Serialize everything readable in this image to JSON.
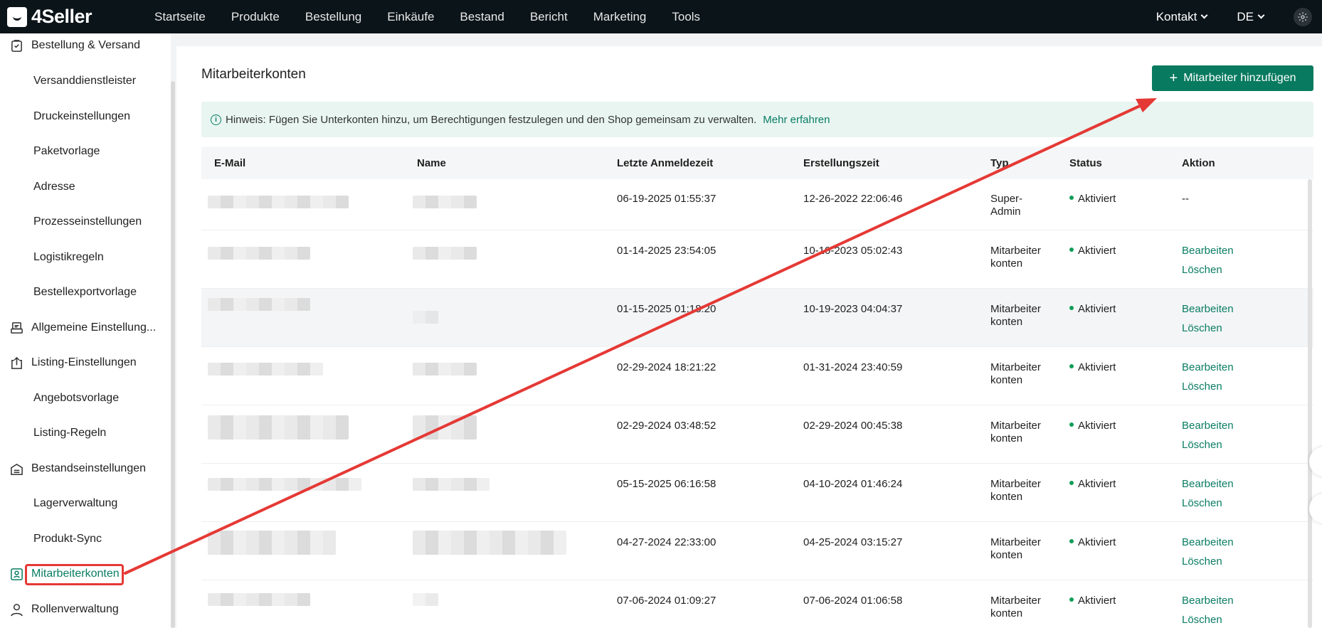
{
  "brand": {
    "name": "4Seller"
  },
  "nav": {
    "items": [
      "Startseite",
      "Produkte",
      "Bestellung",
      "Einkäufe",
      "Bestand",
      "Bericht",
      "Marketing",
      "Tools"
    ],
    "contact": "Kontakt",
    "language": "DE"
  },
  "sidebar": {
    "items": [
      {
        "label": "Bestellung & Versand",
        "type": "group",
        "icon": "clipboard-icon"
      },
      {
        "label": "Versanddienstleister",
        "type": "sub"
      },
      {
        "label": "Druckeinstellungen",
        "type": "sub"
      },
      {
        "label": "Paketvorlage",
        "type": "sub"
      },
      {
        "label": "Adresse",
        "type": "sub"
      },
      {
        "label": "Prozesseinstellungen",
        "type": "sub"
      },
      {
        "label": "Logistikregeln",
        "type": "sub"
      },
      {
        "label": "Bestellexportvorlage",
        "type": "sub"
      },
      {
        "label": "Allgemeine Einstellung...",
        "type": "group",
        "icon": "printer-icon"
      },
      {
        "label": "Listing-Einstellungen",
        "type": "group",
        "icon": "upload-icon"
      },
      {
        "label": "Angebotsvorlage",
        "type": "sub"
      },
      {
        "label": "Listing-Regeln",
        "type": "sub"
      },
      {
        "label": "Bestandseinstellungen",
        "type": "group",
        "icon": "inventory-icon"
      },
      {
        "label": "Lagerverwaltung",
        "type": "sub"
      },
      {
        "label": "Produkt-Sync",
        "type": "sub"
      },
      {
        "label": "Mitarbeiterkonten",
        "type": "group",
        "icon": "badge-icon",
        "active": true
      },
      {
        "label": "Rollenverwaltung",
        "type": "group",
        "icon": "user-icon"
      }
    ]
  },
  "page": {
    "title": "Mitarbeiterkonten",
    "add_button": "Mitarbeiter hinzufügen",
    "hint": "Hinweis: Fügen Sie Unterkonten hinzu, um Berechtigungen festzulegen und den Shop gemeinsam zu verwalten.",
    "hint_link": "Mehr erfahren"
  },
  "table": {
    "columns": [
      "E-Mail",
      "Name",
      "Letzte Anmeldezeit",
      "Erstellungszeit",
      "Typ",
      "Status",
      "Aktion"
    ],
    "rows": [
      {
        "last_login": "06-19-2025 01:55:37",
        "created": "12-26-2022 22:06:46",
        "type": "Super-Admin",
        "status": "Aktiviert",
        "edit": "",
        "delete": "",
        "dash": "--"
      },
      {
        "last_login": "01-14-2025 23:54:05",
        "created": "10-10-2023 05:02:43",
        "type": "Mitarbeiterkonten",
        "status": "Aktiviert",
        "edit": "Bearbeiten",
        "delete": "Löschen"
      },
      {
        "last_login": "01-15-2025 01:18:20",
        "created": "10-19-2023 04:04:37",
        "type": "Mitarbeiterkonten",
        "status": "Aktiviert",
        "edit": "Bearbeiten",
        "delete": "Löschen"
      },
      {
        "last_login": "02-29-2024 18:21:22",
        "created": "01-31-2024 23:40:59",
        "type": "Mitarbeiterkonten",
        "status": "Aktiviert",
        "edit": "Bearbeiten",
        "delete": "Löschen"
      },
      {
        "last_login": "02-29-2024 03:48:52",
        "created": "02-29-2024 00:45:38",
        "type": "Mitarbeiterkonten",
        "status": "Aktiviert",
        "edit": "Bearbeiten",
        "delete": "Löschen"
      },
      {
        "last_login": "05-15-2025 06:16:58",
        "created": "04-10-2024 01:46:24",
        "type": "Mitarbeiterkonten",
        "status": "Aktiviert",
        "edit": "Bearbeiten",
        "delete": "Löschen"
      },
      {
        "last_login": "04-27-2024 22:33:00",
        "created": "04-25-2024 03:15:27",
        "type": "Mitarbeiterkonten",
        "status": "Aktiviert",
        "edit": "Bearbeiten",
        "delete": "Löschen"
      },
      {
        "last_login": "07-06-2024 01:09:27",
        "created": "07-06-2024 01:06:58",
        "type": "Mitarbeiterkonten",
        "status": "Aktiviert",
        "edit": "Bearbeiten",
        "delete": "Löschen"
      }
    ]
  },
  "colors": {
    "brand_green": "#087a5f",
    "topbar": "#0b1419",
    "annotation_red": "#e53935",
    "status_green": "#0f9d58"
  }
}
